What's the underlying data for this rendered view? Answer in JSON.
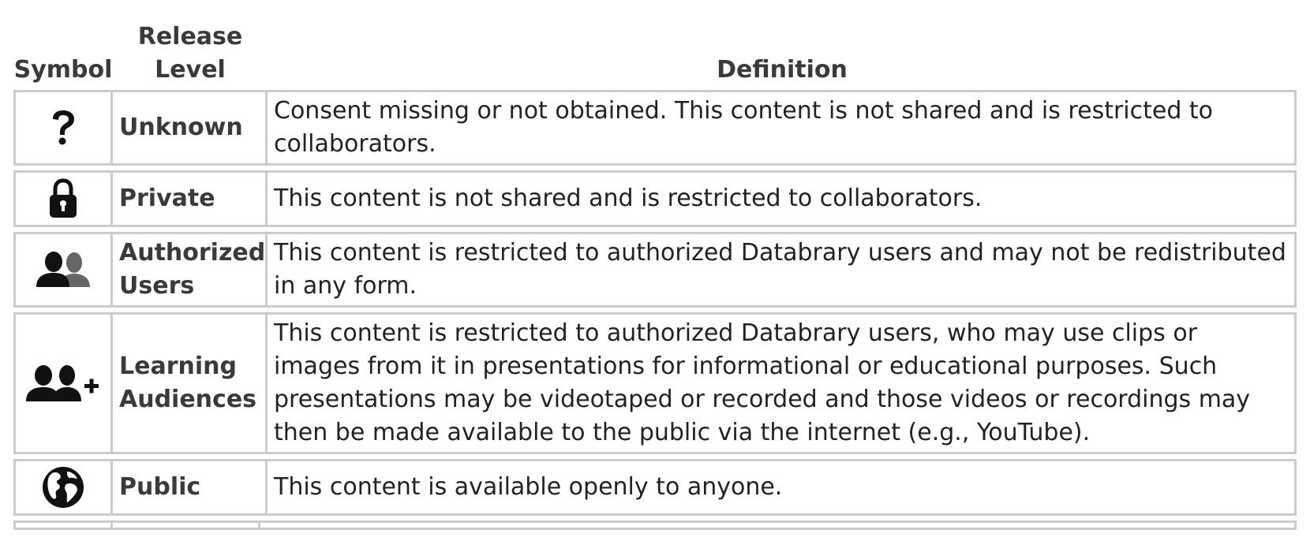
{
  "headers": {
    "symbol": "Symbol",
    "release_level_line1": "Release",
    "release_level_line2": "Level",
    "definition": "Definition"
  },
  "rows": [
    {
      "icon": "question-icon",
      "level": "Unknown",
      "level_line2": "",
      "definition": "Consent missing or not obtained. This content is not shared and is restricted to collaborators."
    },
    {
      "icon": "lock-icon",
      "level": "Private",
      "level_line2": "",
      "definition": "This content is not shared and is restricted to collaborators."
    },
    {
      "icon": "users-icon",
      "level": "Authorized",
      "level_line2": "Users",
      "definition": "This content is restricted to authorized Databrary users and may not be redistributed in any form."
    },
    {
      "icon": "users-plus-icon",
      "level": "Learning",
      "level_line2": "Audiences",
      "definition": "This content is restricted to authorized Databrary users, who may use clips or images from it in presentations for informational or educational purposes. Such presentations may be videotaped or recorded and those videos or recordings may then be made available to the public via the internet (e.g., YouTube)."
    },
    {
      "icon": "globe-icon",
      "level": "Public",
      "level_line2": "",
      "definition": "This content is available openly to anyone."
    }
  ],
  "colors": {
    "border": "#cccccc",
    "text": "#222222",
    "heading": "#3a3a3a",
    "icon": "#111111",
    "icon_secondary": "#666666"
  }
}
